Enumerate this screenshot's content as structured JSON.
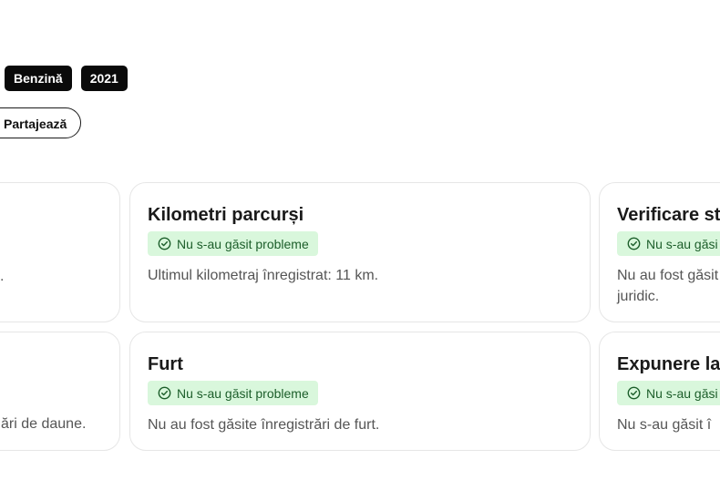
{
  "tags": [
    "Benzină",
    "2021"
  ],
  "share_button": {
    "label": "Partajează"
  },
  "cards": {
    "left_top": {
      "desc": "."
    },
    "km": {
      "title": "Kilometri parcurși",
      "badge": "Nu s-au găsit probleme",
      "desc": "Ultimul kilometraj înregistrat: 11 km."
    },
    "legal": {
      "title": "Verificare st",
      "badge": "Nu s-au găsi",
      "desc": "Nu au fost găsit juridic."
    },
    "left_bottom": {
      "desc": "ări de daune."
    },
    "theft": {
      "title": "Furt",
      "badge": "Nu s-au găsit probleme",
      "desc": "Nu au fost găsite înregistrări de furt."
    },
    "exposure": {
      "title": "Expunere la",
      "badge": "Nu s-au găsi",
      "desc": "Nu s-au găsit î"
    }
  },
  "colors": {
    "tag_bg": "#0a0a0a",
    "badge_bg": "#d9f7dc",
    "badge_text": "#1c5e2a",
    "card_border": "#e6e6e6"
  },
  "icons": {
    "status": "check-circle-icon"
  }
}
